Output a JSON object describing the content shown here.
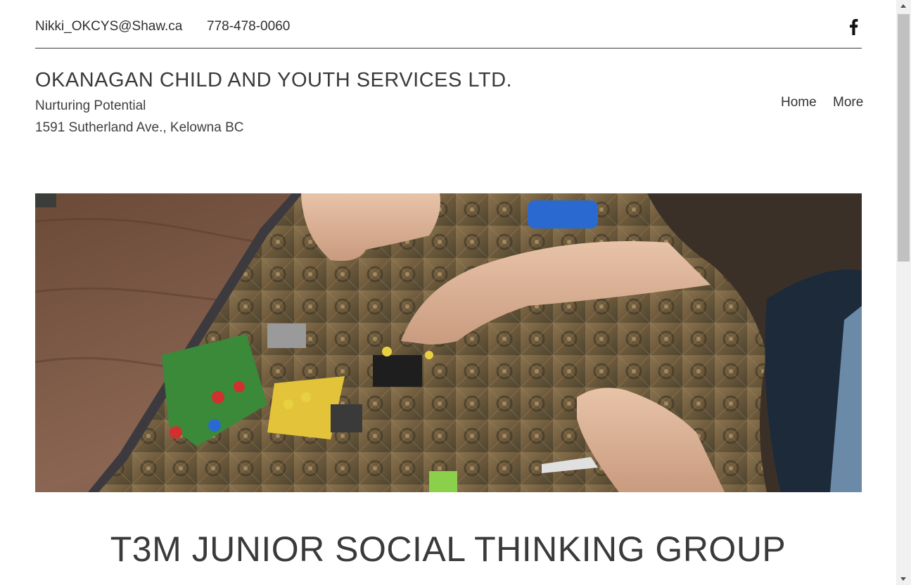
{
  "topbar": {
    "email": "Nikki_OKCYS@Shaw.ca",
    "phone": "778-478-0060",
    "social_icon": "facebook-icon"
  },
  "header": {
    "title": "OKANAGAN CHILD AND YOUTH SERVICES LTD.",
    "tagline": "Nurturing Potential",
    "address": "1591 Sutherland Ave., Kelowna BC"
  },
  "nav": {
    "items": [
      {
        "label": "Home"
      },
      {
        "label": "More"
      }
    ]
  },
  "hero": {
    "image_subject": "children building with lego figures on a patterned rug"
  },
  "main": {
    "headline": "T3M JUNIOR SOCIAL THINKING GROUP"
  },
  "colors": {
    "text": "#3a3a3a",
    "divider": "#3a3a3a",
    "background": "#ffffff"
  }
}
